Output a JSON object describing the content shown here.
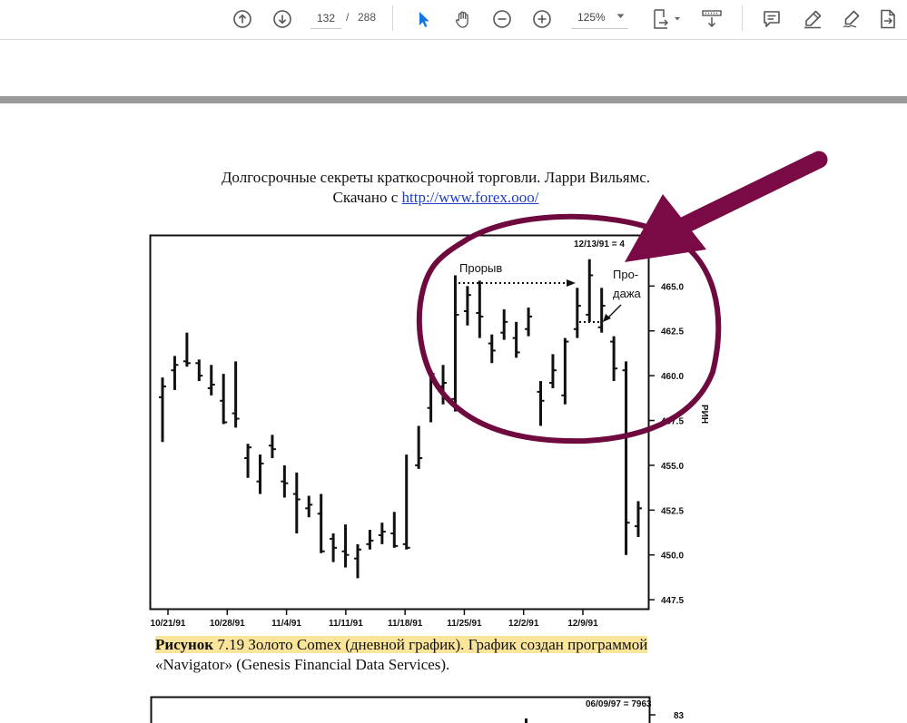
{
  "toolbar": {
    "page_current": "132",
    "page_separator": "/",
    "page_total": "288",
    "zoom": "125%",
    "icons": [
      "prev-page-icon",
      "next-page-icon",
      "select-cursor-icon",
      "hand-tool-icon",
      "zoom-out-icon",
      "zoom-in-icon",
      "page-fit-icon",
      "scroll-mode-icon",
      "comment-icon",
      "highlight-pen-icon",
      "sign-icon",
      "export-pdf-icon"
    ],
    "accent": "#1473e6"
  },
  "document": {
    "header_line1": "Долгосрочные секреты краткосрочной торговли. Ларри Вильямс.",
    "header_line2_prefix": "Скачано с ",
    "header_link": "http://www.forex.ooo/",
    "caption_bold": "Рисунок",
    "caption_rest": " 7.19 Золото Comex (дневной график). График создан программой",
    "caption_line2": "«Navigator» (Genesis Financial Data Services)."
  },
  "chart_data": {
    "type": "bar",
    "subtype": "ohlc",
    "date_stamp": "12/13/91 = 4",
    "x_tick_labels": [
      "10/21/91",
      "10/28/91",
      "11/4/91",
      "11/11/91",
      "11/18/91",
      "11/25/91",
      "12/2/91",
      "12/9/91"
    ],
    "y_tick_labels": [
      "465.0",
      "462.5",
      "460.0",
      "457.5",
      "455.0",
      "452.5",
      "450.0",
      "447.5"
    ],
    "y_ticks": [
      465.0,
      462.5,
      460.0,
      457.5,
      455.0,
      452.5,
      450.0,
      447.5
    ],
    "ylim": [
      447.0,
      467.8
    ],
    "axis_side_label": "РИН",
    "annotations": [
      "Прорыв",
      "Про-",
      "дажа"
    ],
    "bars": [
      {
        "h": 459.9,
        "l": 456.3,
        "o": 458.8,
        "c": 459.4
      },
      {
        "h": 461.1,
        "l": 459.2,
        "o": 460.3,
        "c": 460.6
      },
      {
        "h": 462.4,
        "l": 460.5,
        "o": 460.8,
        "c": 460.7
      },
      {
        "h": 460.9,
        "l": 459.7,
        "o": 460.7,
        "c": 460.0
      },
      {
        "h": 460.6,
        "l": 458.9,
        "o": 459.3,
        "c": 459.5
      },
      {
        "h": 460.1,
        "l": 457.3,
        "o": 458.6,
        "c": 457.4
      },
      {
        "h": 460.8,
        "l": 457.1,
        "o": 457.9,
        "c": 457.6
      },
      {
        "h": 456.2,
        "l": 454.3,
        "o": 455.4,
        "c": 456.0
      },
      {
        "h": 455.6,
        "l": 453.4,
        "o": 454.1,
        "c": 455.1
      },
      {
        "h": 456.7,
        "l": 455.4,
        "o": 456.1,
        "c": 455.9
      },
      {
        "h": 455.0,
        "l": 453.2,
        "o": 454.1,
        "c": 454.0
      },
      {
        "h": 454.6,
        "l": 451.2,
        "o": 453.4,
        "c": 453.1
      },
      {
        "h": 453.3,
        "l": 452.1,
        "o": 452.6,
        "c": 452.8
      },
      {
        "h": 453.4,
        "l": 450.1,
        "o": 452.3,
        "c": 450.2
      },
      {
        "h": 451.2,
        "l": 449.6,
        "o": 450.9,
        "c": 450.4
      },
      {
        "h": 451.7,
        "l": 449.3,
        "o": 450.2,
        "c": 450.0
      },
      {
        "h": 450.6,
        "l": 448.7,
        "o": 449.8,
        "c": 450.3
      },
      {
        "h": 451.4,
        "l": 450.3,
        "o": 450.6,
        "c": 450.8
      },
      {
        "h": 451.8,
        "l": 450.6,
        "o": 451.1,
        "c": 451.3
      },
      {
        "h": 452.4,
        "l": 450.4,
        "o": 451.2,
        "c": 450.5
      },
      {
        "h": 455.6,
        "l": 450.3,
        "o": 450.6,
        "c": 450.4
      },
      {
        "h": 457.2,
        "l": 454.8,
        "o": 455.0,
        "c": 455.4
      },
      {
        "h": 460.2,
        "l": 457.4,
        "o": 458.2,
        "c": 460.1
      },
      {
        "h": 460.6,
        "l": 458.4,
        "o": 459.4,
        "c": 459.6
      },
      {
        "h": 465.6,
        "l": 458.0,
        "o": 458.7,
        "c": 463.4
      },
      {
        "h": 465.0,
        "l": 462.8,
        "o": 463.6,
        "c": 464.5
      },
      {
        "h": 465.3,
        "l": 462.1,
        "o": 463.5,
        "c": 463.3
      },
      {
        "h": 462.3,
        "l": 460.7,
        "o": 461.8,
        "c": 461.4
      },
      {
        "h": 463.7,
        "l": 462.0,
        "o": 462.4,
        "c": 463.0
      },
      {
        "h": 463.0,
        "l": 461.0,
        "o": 462.1,
        "c": 461.3
      },
      {
        "h": 463.8,
        "l": 462.2,
        "o": 462.6,
        "c": 463.3
      },
      {
        "h": 459.7,
        "l": 457.2,
        "o": 459.1,
        "c": 458.6
      },
      {
        "h": 461.2,
        "l": 459.3,
        "o": 459.6,
        "c": 460.3
      },
      {
        "h": 462.1,
        "l": 458.4,
        "o": 458.9,
        "c": 461.9
      },
      {
        "h": 464.9,
        "l": 462.1,
        "o": 462.6,
        "c": 463.9
      },
      {
        "h": 466.5,
        "l": 463.0,
        "o": 463.4,
        "c": 465.6
      },
      {
        "h": 464.9,
        "l": 462.4,
        "o": 462.7,
        "c": 463.9
      },
      {
        "h": 462.2,
        "l": 459.7,
        "o": 461.9,
        "c": 460.4
      },
      {
        "h": 460.8,
        "l": 450.0,
        "o": 460.3,
        "c": 451.8
      },
      {
        "h": 453.0,
        "l": 451.0,
        "o": 451.6,
        "c": 452.6
      }
    ]
  }
}
